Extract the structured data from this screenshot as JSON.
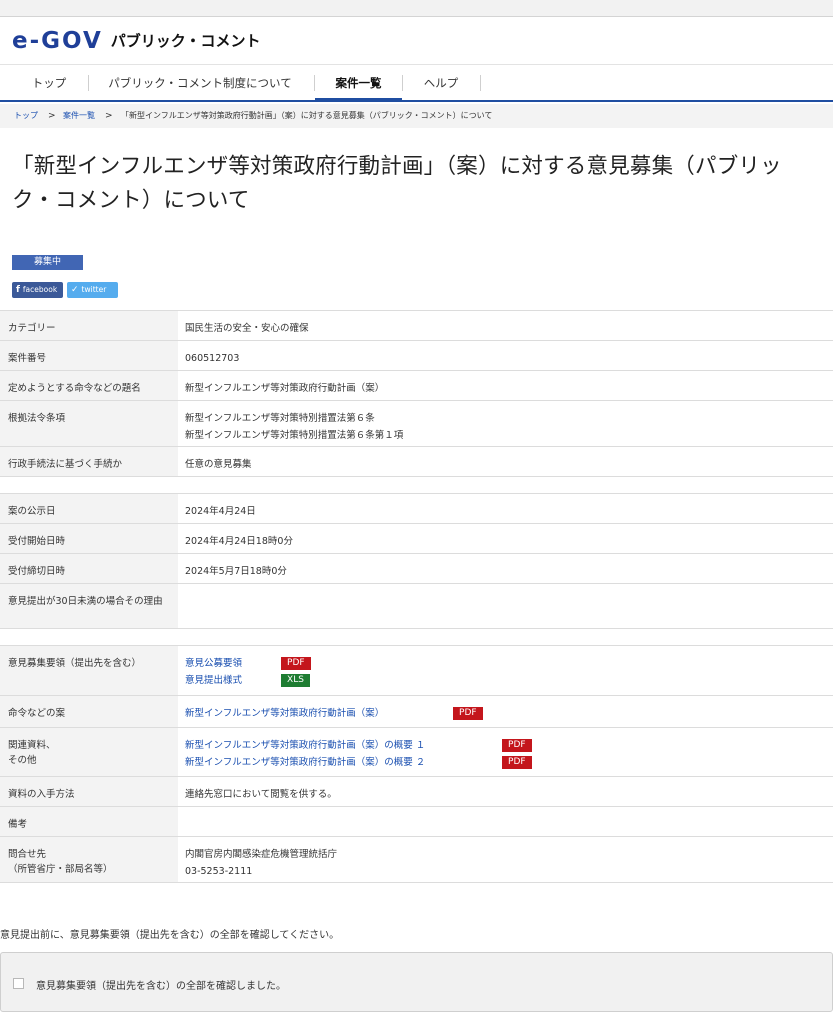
{
  "site": {
    "logo_mark": "e-GOV",
    "logo_text": "パブリック・コメント"
  },
  "nav": {
    "items": [
      {
        "label": "トップ"
      },
      {
        "label": "パブリック・コメント制度について"
      },
      {
        "label": "案件一覧"
      },
      {
        "label": "ヘルプ"
      }
    ],
    "active": "案件一覧"
  },
  "breadcrumb": {
    "items": [
      "トップ",
      "案件一覧"
    ],
    "separator": ">",
    "current": "「新型インフルエンザ等対策政府行動計画」（案）に対する意見募集（パブリック・コメント）について"
  },
  "page": {
    "title_line1": "「新型インフルエンザ等対策政府行動計画」（案）に対する意見募集（パブリッ",
    "title_line2": "ク・コメント）について",
    "status_badge": "募集中",
    "share": {
      "facebook": "facebook",
      "twitter": "twitter"
    }
  },
  "details": {
    "category": {
      "label": "カテゴリー",
      "value": "国民生活の安全・安心の確保"
    },
    "case_no": {
      "label": "案件番号",
      "value": "060512703"
    },
    "title": {
      "label": "定めようとする命令などの題名",
      "value": "新型インフルエンザ等対策政府行動計画（案）"
    },
    "basis": {
      "label": "根拠法令条項",
      "values": [
        "新型インフルエンザ等対策特別措置法第６条",
        "新型インフルエンザ等対策特別措置法第６条第１項"
      ]
    },
    "procedure": {
      "label": "行政手続法に基づく手続か",
      "value": "任意の意見募集"
    }
  },
  "dates": {
    "announce": {
      "label": "案の公示日",
      "value": "2024年4月24日"
    },
    "start": {
      "label": "受付開始日時",
      "value": "2024年4月24日18時0分"
    },
    "end": {
      "label": "受付締切日時",
      "value": "2024年5月7日18時0分"
    },
    "reason": {
      "label": "意見提出が30日未満の場合その理由",
      "value": ""
    }
  },
  "documents": {
    "guidelines": {
      "label": "意見募集要領（提出先を含む）",
      "items": [
        {
          "text": "意見公募要領",
          "type": "PDF"
        },
        {
          "text": "意見提出様式",
          "type": "XLS"
        }
      ]
    },
    "draft": {
      "label": "命令などの案",
      "items": [
        {
          "text": "新型インフルエンザ等対策政府行動計画（案）",
          "type": "PDF"
        }
      ]
    },
    "related": {
      "label_line1": "関連資料、",
      "label_line2": "その他",
      "items": [
        {
          "text": "新型インフルエンザ等対策政府行動計画（案）の概要 １",
          "type": "PDF"
        },
        {
          "text": "新型インフルエンザ等対策政府行動計画（案）の概要 ２",
          "type": "PDF"
        }
      ]
    },
    "obtain": {
      "label": "資料の入手方法",
      "value": "連絡先窓口において閲覧を供する。"
    },
    "remarks": {
      "label": "備考",
      "value": ""
    },
    "contact": {
      "label_line1": "問合せ先",
      "label_line2": "（所管省庁・部局名等）",
      "org": "内閣官房内閣感染症危機管理統括庁",
      "tel": "03-5253-2111"
    }
  },
  "notice": "意見提出前に、意見募集要領（提出先を含む）の全部を確認してください。",
  "confirm": {
    "label": "意見募集要領（提出先を含む）の全部を確認しました。",
    "checked": false
  },
  "colors": {
    "brand": "#1f3f98",
    "nav_active": "#1f4ea1",
    "badge": "#4166b4",
    "pdf": "#c4161c",
    "xls": "#1e7d32",
    "link": "#1a4fb0"
  }
}
